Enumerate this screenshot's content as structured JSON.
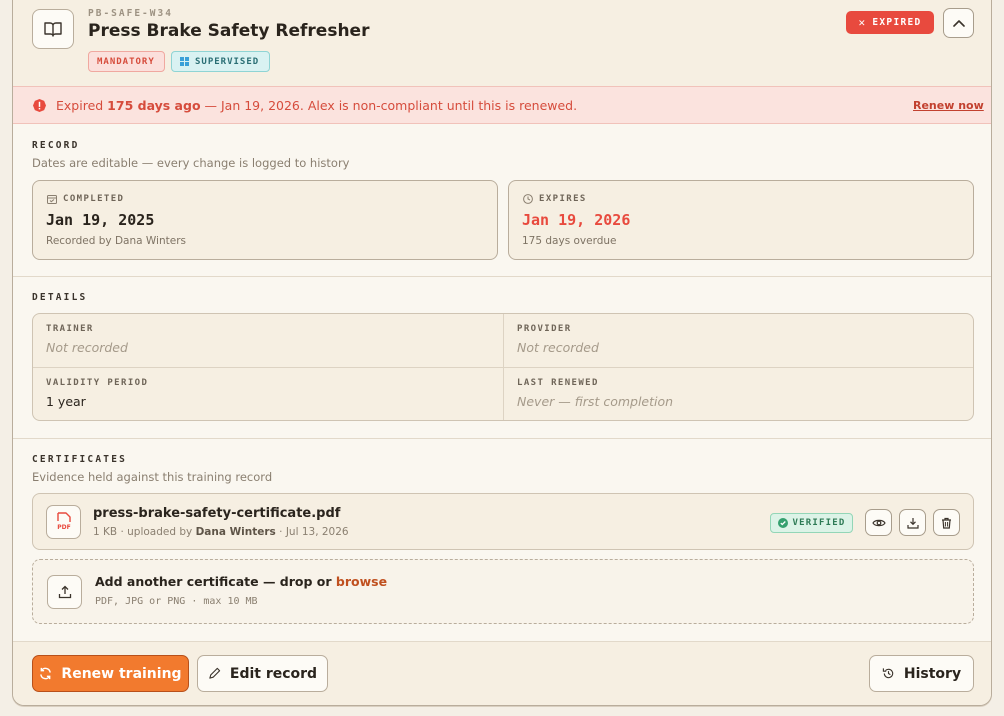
{
  "header": {
    "code": "PB-SAFE-W34",
    "title": "Press Brake Safety Refresher",
    "tags": {
      "mandatory": "MANDATORY",
      "supervised": "SUPERVISED"
    },
    "status_badge": "EXPIRED"
  },
  "alert": {
    "prefix": "Expired ",
    "highlight": "175 days ago",
    "rest": " — Jan 19, 2026. Alex is non-compliant until this is renewed.",
    "action": "Renew now"
  },
  "record": {
    "label": "RECORD",
    "sub": "Dates are editable — every change is logged to history",
    "completed": {
      "label": "COMPLETED",
      "value": "Jan 19, 2025",
      "note": "Recorded by Dana Winters"
    },
    "expires": {
      "label": "EXPIRES",
      "value": "Jan 19, 2026",
      "note": "175 days overdue"
    }
  },
  "details": {
    "label": "DETAILS",
    "trainer": {
      "label": "TRAINER",
      "value": "Not recorded"
    },
    "provider": {
      "label": "PROVIDER",
      "value": "Not recorded"
    },
    "validity": {
      "label": "VALIDITY PERIOD",
      "value": "1 year"
    },
    "last_renewed": {
      "label": "LAST RENEWED",
      "value": "Never — first completion"
    }
  },
  "certificates": {
    "label": "CERTIFICATES",
    "sub": "Evidence held against this training record",
    "file": {
      "icon_text": "PDF",
      "name": "press-brake-safety-certificate.pdf",
      "size": "1 KB · uploaded by ",
      "uploader": "Dana Winters",
      "date": " · Jul 13, 2026",
      "status": "VERIFIED"
    },
    "dropzone": {
      "title": "Add another certificate — drop or ",
      "browse": "browse",
      "formats": "PDF, JPG or PNG · max 10 MB"
    }
  },
  "footer": {
    "renew": "Renew training",
    "edit": "Edit record",
    "history": "History"
  },
  "colors": {
    "accent_orange": "#f27a2e",
    "danger": "#e84a3e",
    "verified_green": "#2e7a55"
  }
}
